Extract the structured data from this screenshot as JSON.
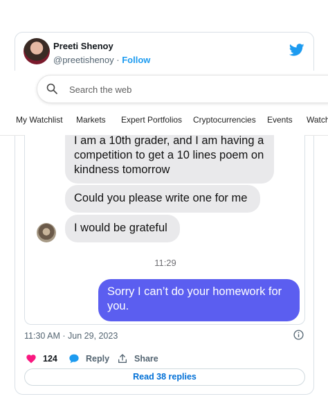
{
  "tweet": {
    "author_name": "Preeti Shenoy",
    "handle": "@preetishenoy",
    "separator": "·",
    "follow_label": "Follow",
    "brand_color": "#1d9bf0",
    "timestamp": "11:30 AM · Jun 29, 2023",
    "likes": "124",
    "reply_label": "Reply",
    "share_label": "Share",
    "read_replies_label": "Read 38 replies"
  },
  "browser_overlay": {
    "search_placeholder": "Search the web",
    "nav_items": [
      "My Watchlist",
      "Markets",
      "Expert Portfolios",
      "Cryptocurrencies",
      "Events",
      "Watche"
    ]
  },
  "chat": {
    "incoming": [
      "I am a 10th grader, and I am having a competition to get a 10 lines poem on kindness tomorrow",
      "Could you please write one for me",
      "I would be grateful"
    ],
    "time": "11:29",
    "outgoing": "Sorry I can’t do your homework for you.",
    "incoming_color": "#e9e9eb",
    "outgoing_color": "#5b5ef0"
  },
  "icons": {
    "bird": "twitter-bird-icon",
    "search": "search-icon",
    "info": "info-icon",
    "like": "heart-icon",
    "reply": "reply-bubble-icon",
    "share": "share-upload-icon"
  }
}
